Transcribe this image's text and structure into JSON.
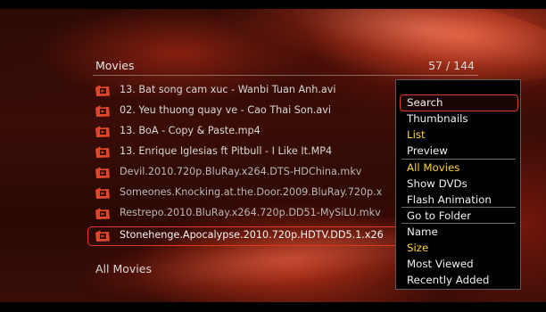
{
  "header": {
    "title": "Movies",
    "count": "57 / 144"
  },
  "files": [
    {
      "name": "13. Bat song cam xuc - Wanbi Tuan Anh.avi"
    },
    {
      "name": "02. Yeu thuong quay ve - Cao Thai Son.avi"
    },
    {
      "name": "13. BoA - Copy & Paste.mp4"
    },
    {
      "name": "13. Enrique Iglesias ft Pitbull - I Like It.MP4"
    },
    {
      "name": "Devil.2010.720p.BluRay.x264.DTS-HDChina.mkv"
    },
    {
      "name": "Someones.Knocking.at.the.Door.2009.BluRay.720p.x"
    },
    {
      "name": "Restrepo.2010.BluRay.x264.720p.DD51-MySiLU.mkv"
    },
    {
      "name": "Stonehenge.Apocalypse.2010.720p.HDTV.DD5.1.x26"
    }
  ],
  "menu": {
    "search": "Search",
    "view": [
      "Thumbnails",
      "List",
      "Preview"
    ],
    "filter": [
      "All Movies",
      "Show DVDs",
      "Flash Animation"
    ],
    "folder": "Go to Folder",
    "sort": [
      "Name",
      "Size",
      "Most Viewed",
      "Recently Added"
    ]
  },
  "footer": {
    "filter_label": "All Movies"
  },
  "colors": {
    "accent": "#e23a1e",
    "highlight": "#ffd22e",
    "icon": "#e0472a"
  },
  "icon_name": "folder-film-icon"
}
